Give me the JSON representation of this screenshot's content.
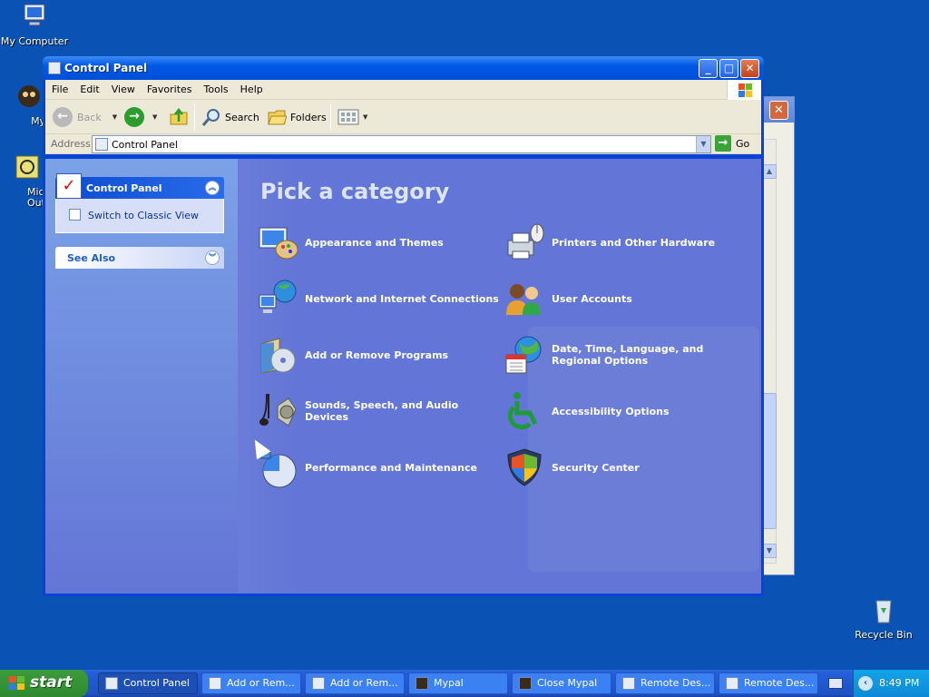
{
  "desktop": {
    "icons": [
      {
        "label": "My Computer"
      },
      {
        "label": "MyPal"
      },
      {
        "label": "Micros Outlo"
      },
      {
        "label": "Recycle Bin"
      }
    ]
  },
  "window": {
    "title": "Control Panel",
    "menu": [
      "File",
      "Edit",
      "View",
      "Favorites",
      "Tools",
      "Help"
    ],
    "toolbar": {
      "back_label": "Back",
      "search_label": "Search",
      "folders_label": "Folders"
    },
    "address": {
      "label": "Address",
      "value": "Control Panel",
      "go_label": "Go"
    },
    "sidebar": {
      "panel_title": "Control Panel",
      "switch_link": "Switch to Classic View",
      "see_also": "See Also"
    },
    "content": {
      "heading": "Pick a category",
      "categories": [
        {
          "label": "Appearance and Themes",
          "icon": "appearance-icon"
        },
        {
          "label": "Printers and Other Hardware",
          "icon": "printer-icon"
        },
        {
          "label": "Network and Internet Connections",
          "icon": "network-icon"
        },
        {
          "label": "User Accounts",
          "icon": "users-icon"
        },
        {
          "label": "Add or Remove Programs",
          "icon": "add-remove-icon"
        },
        {
          "label": "Date, Time, Language, and Regional Options",
          "icon": "globe-calendar-icon"
        },
        {
          "label": "Sounds, Speech, and Audio Devices",
          "icon": "sound-icon"
        },
        {
          "label": "Accessibility Options",
          "icon": "accessibility-icon"
        },
        {
          "label": "Performance and Maintenance",
          "icon": "performance-icon"
        },
        {
          "label": "Security Center",
          "icon": "shield-icon"
        }
      ]
    }
  },
  "taskbar": {
    "start_label": "start",
    "tasks": [
      {
        "label": "Control Panel",
        "active": true
      },
      {
        "label": "Add or Rem...",
        "active": false
      },
      {
        "label": "Add or Rem...",
        "active": false
      },
      {
        "label": "Mypal",
        "active": false
      },
      {
        "label": "Close Mypal",
        "active": false
      },
      {
        "label": "Remote Des...",
        "active": false
      },
      {
        "label": "Remote Des...",
        "active": false
      }
    ],
    "clock": "8:49 PM"
  },
  "colors": {
    "desktop": "#0a53b5",
    "title_bar": "#0058e6",
    "content_bg": "#6375d6",
    "start_green": "#3c9b3c"
  }
}
